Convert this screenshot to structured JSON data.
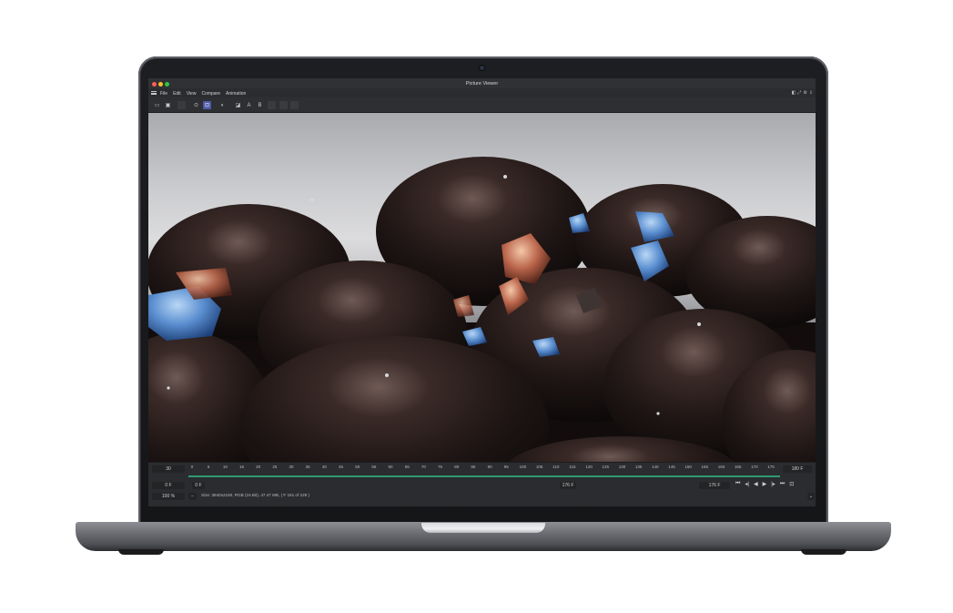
{
  "app": {
    "title": "Picture Viewer",
    "menu": [
      "File",
      "Edit",
      "View",
      "Compare",
      "Animation"
    ]
  },
  "toolbar": {
    "compare_a": "A",
    "compare_b": "B"
  },
  "timeline": {
    "fps": "30",
    "start_field": "0 F",
    "end_field": "180 F",
    "start_marker": "0 F",
    "current_marker": "176 F",
    "current_field": "176 F",
    "ticks": [
      "0",
      "5",
      "10",
      "15",
      "20",
      "25",
      "30",
      "35",
      "40",
      "45",
      "50",
      "55",
      "60",
      "65",
      "70",
      "75",
      "80",
      "85",
      "90",
      "95",
      "100",
      "105",
      "110",
      "115",
      "120",
      "125",
      "130",
      "135",
      "140",
      "145",
      "150",
      "155",
      "160",
      "165",
      "170",
      "175"
    ],
    "zoom": "100 %",
    "status": "Size: 3840x2160, RGB (16 Bit), 47.47 MB, ( F 181 of 229 )"
  },
  "colors": {
    "accent_blue": "#4e5aa8",
    "timeline_green": "#2f9a72",
    "traffic_red": "#ff5f57",
    "traffic_yellow": "#febc2e",
    "traffic_green": "#28c840"
  }
}
